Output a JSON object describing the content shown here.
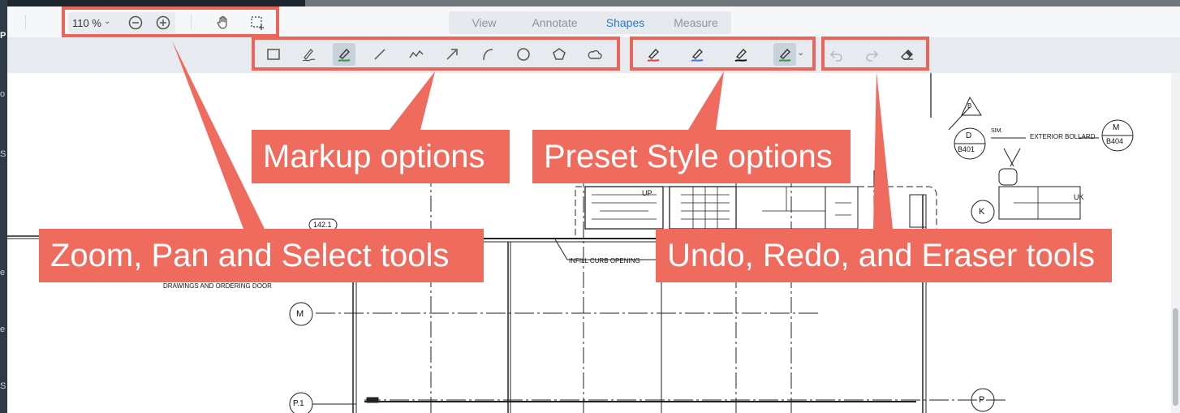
{
  "app": {
    "strip_labels": [
      "P",
      "o",
      "S",
      "e",
      "e",
      "S"
    ]
  },
  "toolbar": {
    "zoom_value": "110 %",
    "tabs": [
      {
        "label": "View",
        "selected": false
      },
      {
        "label": "Annotate",
        "selected": false
      },
      {
        "label": "Shapes",
        "selected": true
      },
      {
        "label": "Measure",
        "selected": false
      }
    ]
  },
  "markup_tools": [
    "rectangle-icon",
    "freehand-pen-icon",
    "highlighter-icon",
    "line-icon",
    "polyline-icon",
    "arrow-icon",
    "arc-icon",
    "circle-icon",
    "polygon-icon",
    "cloud-icon"
  ],
  "style_presets": [
    {
      "icon": "pen-red-icon",
      "color": "#e0413a"
    },
    {
      "icon": "pen-blue-icon",
      "color": "#3d76d9"
    },
    {
      "icon": "pen-black-icon",
      "color": "#111111"
    },
    {
      "icon": "pen-green-icon",
      "color": "#2f9a4a"
    }
  ],
  "callouts": {
    "zoom": "Zoom, Pan and Select tools",
    "markup": "Markup options",
    "preset": "Preset Style options",
    "undo": "Undo, Redo, and Eraser tools"
  },
  "drawing": {
    "tag_142": "142.1",
    "infill": "INFILL CURB OPENING",
    "drawings_door": "DRAWINGS AND ORDERING DOOR",
    "bubble_m": "M",
    "bubble_p1": "P.1",
    "bubble_p": "P",
    "bubble_k": "K",
    "detail_d": "D",
    "detail_d_sheet": "B401",
    "detail_m": "M",
    "detail_m_sheet": "B404",
    "sim": "SIM.",
    "exterior_bollard": "EXTERIOR BOLLARD",
    "rev_b": "B",
    "up": "UP",
    "uk": "UK"
  },
  "colors": {
    "callout": "#ee6b5d",
    "active_tab": "#2f7bbf"
  }
}
